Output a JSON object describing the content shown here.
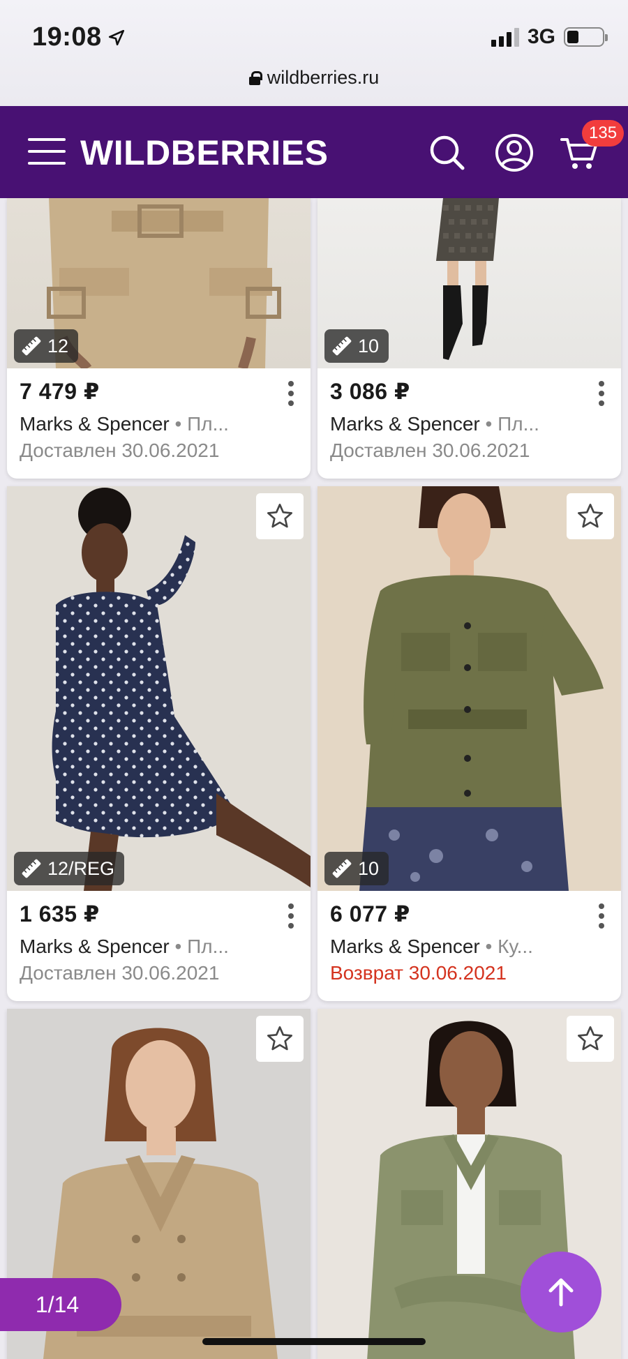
{
  "status_bar": {
    "time": "19:08",
    "network": "3G",
    "url": "wildberries.ru"
  },
  "header": {
    "logo": "WILDBERRIES",
    "cart_count": "135"
  },
  "products": [
    {
      "price": "7 479 ₽",
      "brand": "Marks & Spencer",
      "subtitle": " • Пл...",
      "status": "Доставлен 30.06.2021",
      "size": "12",
      "status_type": "delivered"
    },
    {
      "price": "3 086 ₽",
      "brand": "Marks & Spencer",
      "subtitle": " • Пл...",
      "status": "Доставлен 30.06.2021",
      "size": "10",
      "status_type": "delivered"
    },
    {
      "price": "1 635 ₽",
      "brand": "Marks & Spencer",
      "subtitle": " • Пл...",
      "status": "Доставлен 30.06.2021",
      "size": "12/REG",
      "status_type": "delivered"
    },
    {
      "price": "6 077 ₽",
      "brand": "Marks & Spencer",
      "subtitle": " • Ку...",
      "status": "Возврат 30.06.2021",
      "size": "10",
      "status_type": "return"
    }
  ],
  "pager": {
    "label": "1/14"
  },
  "colors": {
    "brand": "#481173",
    "accent": "#a04fd9",
    "badge": "#f23d3d",
    "return": "#d4331f"
  }
}
